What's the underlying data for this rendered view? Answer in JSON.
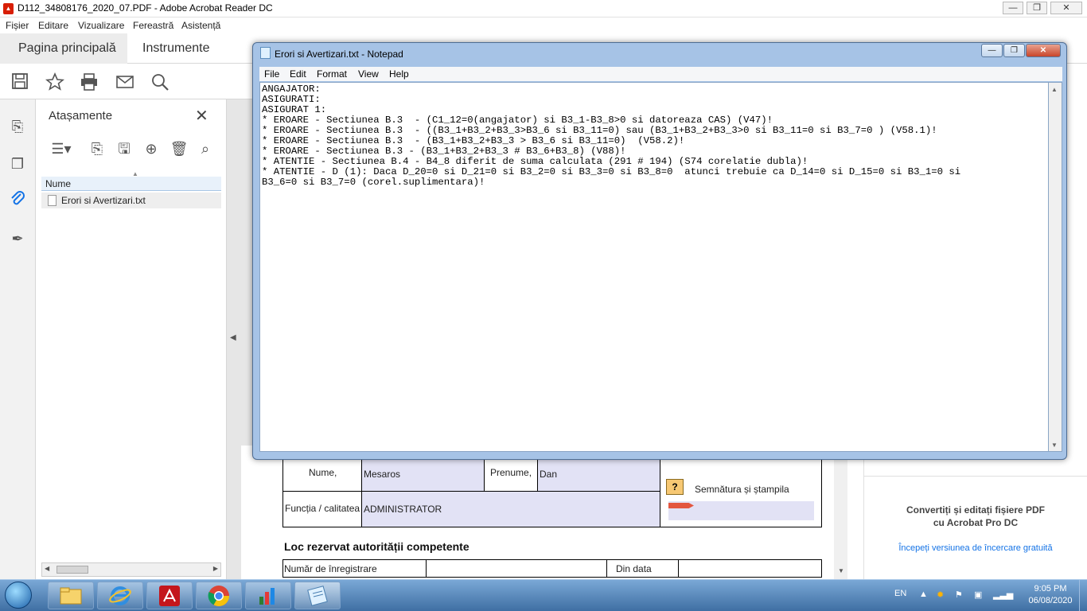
{
  "acrobat": {
    "title": "D112_34808176_2020_07.PDF - Adobe Acrobat Reader DC",
    "window_buttons": {
      "minimize": "—",
      "restore": "❐",
      "close": "✕"
    },
    "menu": [
      "Fișier",
      "Editare",
      "Vizualizare",
      "Fereastră",
      "Asistență"
    ],
    "tabs": {
      "home": "Pagina principală",
      "tools": "Instrumente"
    },
    "toolbar_icons": [
      "save-icon",
      "star-icon",
      "print-icon",
      "mail-icon",
      "search-icon"
    ],
    "rail_icons": [
      "pages-export-icon",
      "pages-icon",
      "paperclip-icon",
      "sign-icon"
    ]
  },
  "attachments": {
    "header": "Atașamente",
    "column": "Nume",
    "file": "Erori si Avertizari.txt"
  },
  "form": {
    "nume_label": "Nume,",
    "nume_value": "Mesaros",
    "prenume_label": "Prenume,",
    "prenume_value": "Dan",
    "functia_label": "Funcția / calitatea",
    "functia_value": "ADMINISTRATOR",
    "semnatura_label": "Semnătura și ștampila",
    "help_mark": "?",
    "section_title": "Loc rezervat autorității competente",
    "nr_inregistrare": "Număr de înregistrare",
    "din_data": "Din data"
  },
  "promo": {
    "line1": "Convertiți și editați fișiere PDF",
    "line2": "cu Acrobat Pro DC",
    "trial": "Începeți versiunea de încercare gratuită"
  },
  "notepad": {
    "title": "Erori si Avertizari.txt - Notepad",
    "menu": [
      "File",
      "Edit",
      "Format",
      "View",
      "Help"
    ],
    "content": "ANGAJATOR:\nASIGURATI:\nASIGURAT 1:\n* EROARE - Sectiunea B.3  - (C1_12=0(angajator) si B3_1-B3_8>0 si datoreaza CAS) (V47)!\n* EROARE - Sectiunea B.3  - ((B3_1+B3_2+B3_3>B3_6 si B3_11=0) sau (B3_1+B3_2+B3_3>0 si B3_11=0 si B3_7=0 ) (V58.1)!\n* EROARE - Sectiunea B.3  - (B3_1+B3_2+B3_3 > B3_6 si B3_11=0)  (V58.2)!\n* EROARE - Sectiunea B.3 - (B3_1+B3_2+B3_3 # B3_6+B3_8) (V88)!\n* ATENTIE - Sectiunea B.4 - B4_8 diferit de suma calculata (291 # 194) (S74 corelatie dubla)!\n* ATENTIE - D (1): Daca D_20=0 si D_21=0 si B3_2=0 si B3_3=0 si B3_8=0  atunci trebuie ca D_14=0 si D_15=0 si B3_1=0 si\nB3_6=0 si B3_7=0 (corel.suplimentara)!"
  },
  "taskbar": {
    "language": "EN",
    "time": "9:05 PM",
    "date": "06/08/2020",
    "apps": [
      "explorer-icon",
      "ie-icon",
      "acrobat-icon",
      "chrome-icon",
      "spreadsheet-icon",
      "notepad-icon"
    ]
  }
}
